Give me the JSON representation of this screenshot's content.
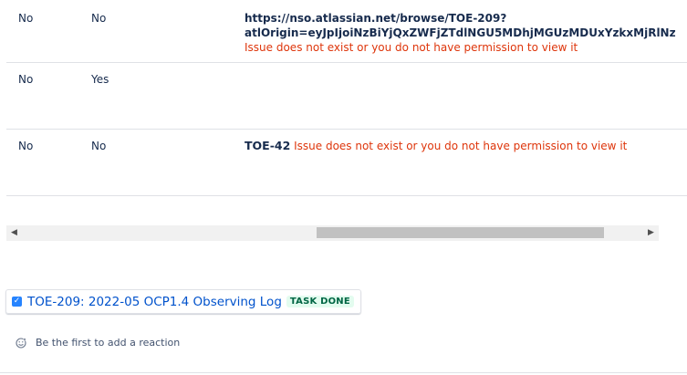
{
  "table": {
    "rows": [
      {
        "col1": "No",
        "col2": "No",
        "link_line1": "https://nso.atlassian.net/browse/TOE-209?",
        "link_line2": "atlOrigin=eyJpIjoiNzBiYjQxZWFjZTdlNGU5MDhjMGUzMDUxYzkxMjRlNz",
        "error": "Issue does not exist or you do not have permission to view it"
      },
      {
        "col1": "No",
        "col2": "Yes"
      },
      {
        "col1": "No",
        "col2": "No",
        "issue_key": "TOE-42",
        "error": "Issue does not exist or you do not have permission to view it"
      }
    ]
  },
  "task": {
    "title": "TOE-209: 2022-05 OCP1.4 Observing Log",
    "status": "TASK DONE",
    "checked": true
  },
  "reaction": {
    "text": "Be the first to add a reaction",
    "icon": "add-reaction-icon"
  },
  "scrollbar": {
    "left_icon": "scroll-left-arrow-icon",
    "right_icon": "scroll-right-arrow-icon"
  },
  "colors": {
    "error": "#de350b",
    "link": "#0052cc",
    "done_bg": "#e3fcef",
    "done_text": "#006644"
  }
}
